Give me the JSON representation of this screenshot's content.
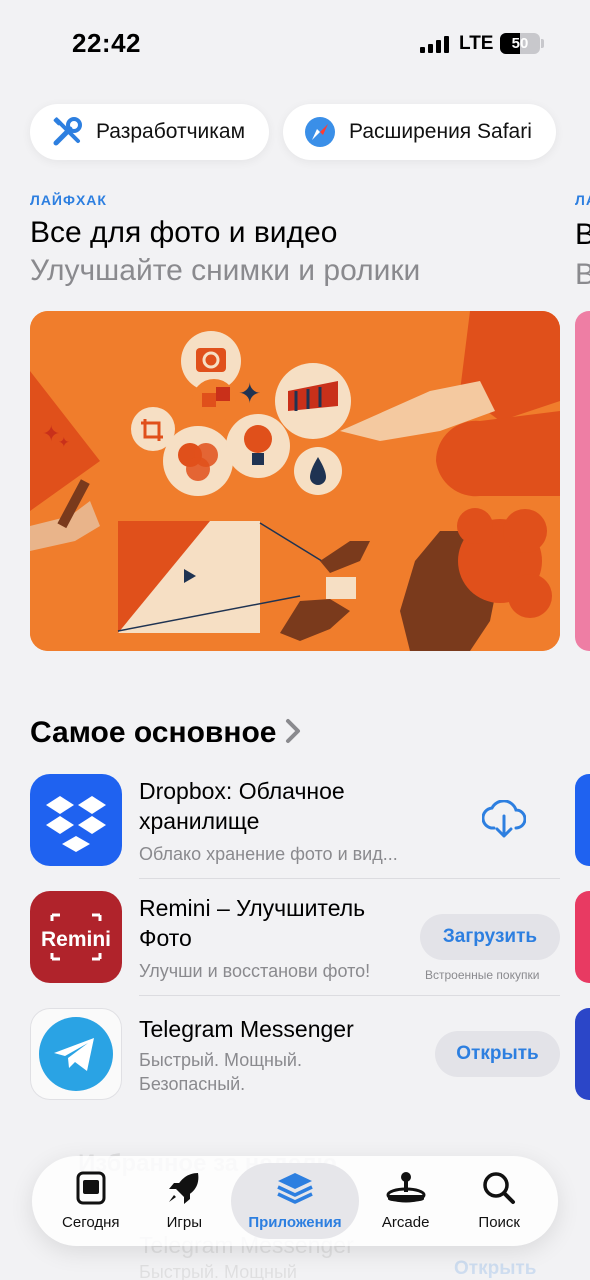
{
  "status_bar": {
    "time": "22:42",
    "network": "LTE",
    "battery_level": "50"
  },
  "category_pills": [
    {
      "label": "Разработчикам",
      "icon": "tools-icon"
    },
    {
      "label": "Расширения Safari",
      "icon": "safari-compass-icon"
    }
  ],
  "featured": {
    "eyebrow": "ЛАЙФХАК",
    "title": "Все для фото и видео",
    "subtitle": "Улучшайте снимки и ролики",
    "next_eyebrow_peek": "ЛА",
    "next_title_peek": "В",
    "next_subtitle_peek": "В"
  },
  "section": {
    "title": "Самое основное",
    "chevron": "chevron-right-icon"
  },
  "apps": [
    {
      "name_line1": "Dropbox: Облачное",
      "name_line2": "хранилище",
      "subtitle": "Облако хранение фото и вид...",
      "action": "download-cloud-icon",
      "action_label": ""
    },
    {
      "name_line1": "Remini – Улучшитель",
      "name_line2": "Фото",
      "subtitle": "Улучши и восстанови фото!",
      "action_label": "Загрузить",
      "iap_note": "Встроенные покупки",
      "icon_text": "Remini"
    },
    {
      "name_line1": "Telegram Messenger",
      "subtitle_line1": "Быстрый. Мощный.",
      "subtitle_line2": "Безопасный.",
      "action_label": "Открыть"
    }
  ],
  "ghost_text": {
    "behind_tabbar_1": "Telegram Messenger",
    "behind_tabbar_2": "Быстрый. Мощный",
    "behind_tabbar_3": "Открыть",
    "behind_tabbar_top": "Избранное за неделю"
  },
  "tabbar": [
    {
      "label": "Сегодня",
      "icon": "today-icon",
      "active": false
    },
    {
      "label": "Игры",
      "icon": "rocket-icon",
      "active": false
    },
    {
      "label": "Приложения",
      "icon": "apps-stack-icon",
      "active": true
    },
    {
      "label": "Arcade",
      "icon": "joystick-icon",
      "active": false
    },
    {
      "label": "Поиск",
      "icon": "search-icon",
      "active": false
    }
  ],
  "colors": {
    "accent": "#2d7fe0",
    "artwork_orange": "#f07d2c",
    "remini_red": "#b0232b",
    "dropbox_blue": "#1f62f0",
    "telegram_blue": "#2aa3e4"
  }
}
